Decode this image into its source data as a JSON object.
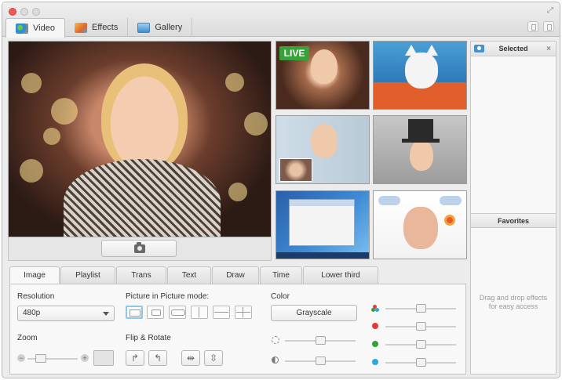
{
  "top_tabs": [
    {
      "label": "Video",
      "icon": "video-camera-icon",
      "active": true
    },
    {
      "label": "Effects",
      "icon": "effects-icon",
      "active": false
    },
    {
      "label": "Gallery",
      "icon": "gallery-icon",
      "active": false
    }
  ],
  "thumbnails": {
    "live_badge": "LIVE"
  },
  "sidebar": {
    "selected_title": "Selected",
    "favorites_title": "Favorites",
    "hint": "Drag and drop effects for easy access"
  },
  "control_tabs": [
    {
      "label": "Image",
      "active": true
    },
    {
      "label": "Playlist",
      "active": false
    },
    {
      "label": "Trans",
      "active": false
    },
    {
      "label": "Text",
      "active": false
    },
    {
      "label": "Draw",
      "active": false
    },
    {
      "label": "Time",
      "active": false
    },
    {
      "label": "Lower third",
      "active": false
    }
  ],
  "image_panel": {
    "resolution_label": "Resolution",
    "resolution_value": "480p",
    "zoom_label": "Zoom",
    "pip_label": "Picture in Picture mode:",
    "flip_label": "Flip & Rotate",
    "color_label": "Color",
    "color_button": "Grayscale"
  },
  "colors": {
    "live_green": "#3aa13a",
    "red_channel": "#e53935",
    "green_channel": "#2ea43a",
    "blue_channel": "#29a8e0",
    "accent_selection": "#8cc6ea"
  }
}
